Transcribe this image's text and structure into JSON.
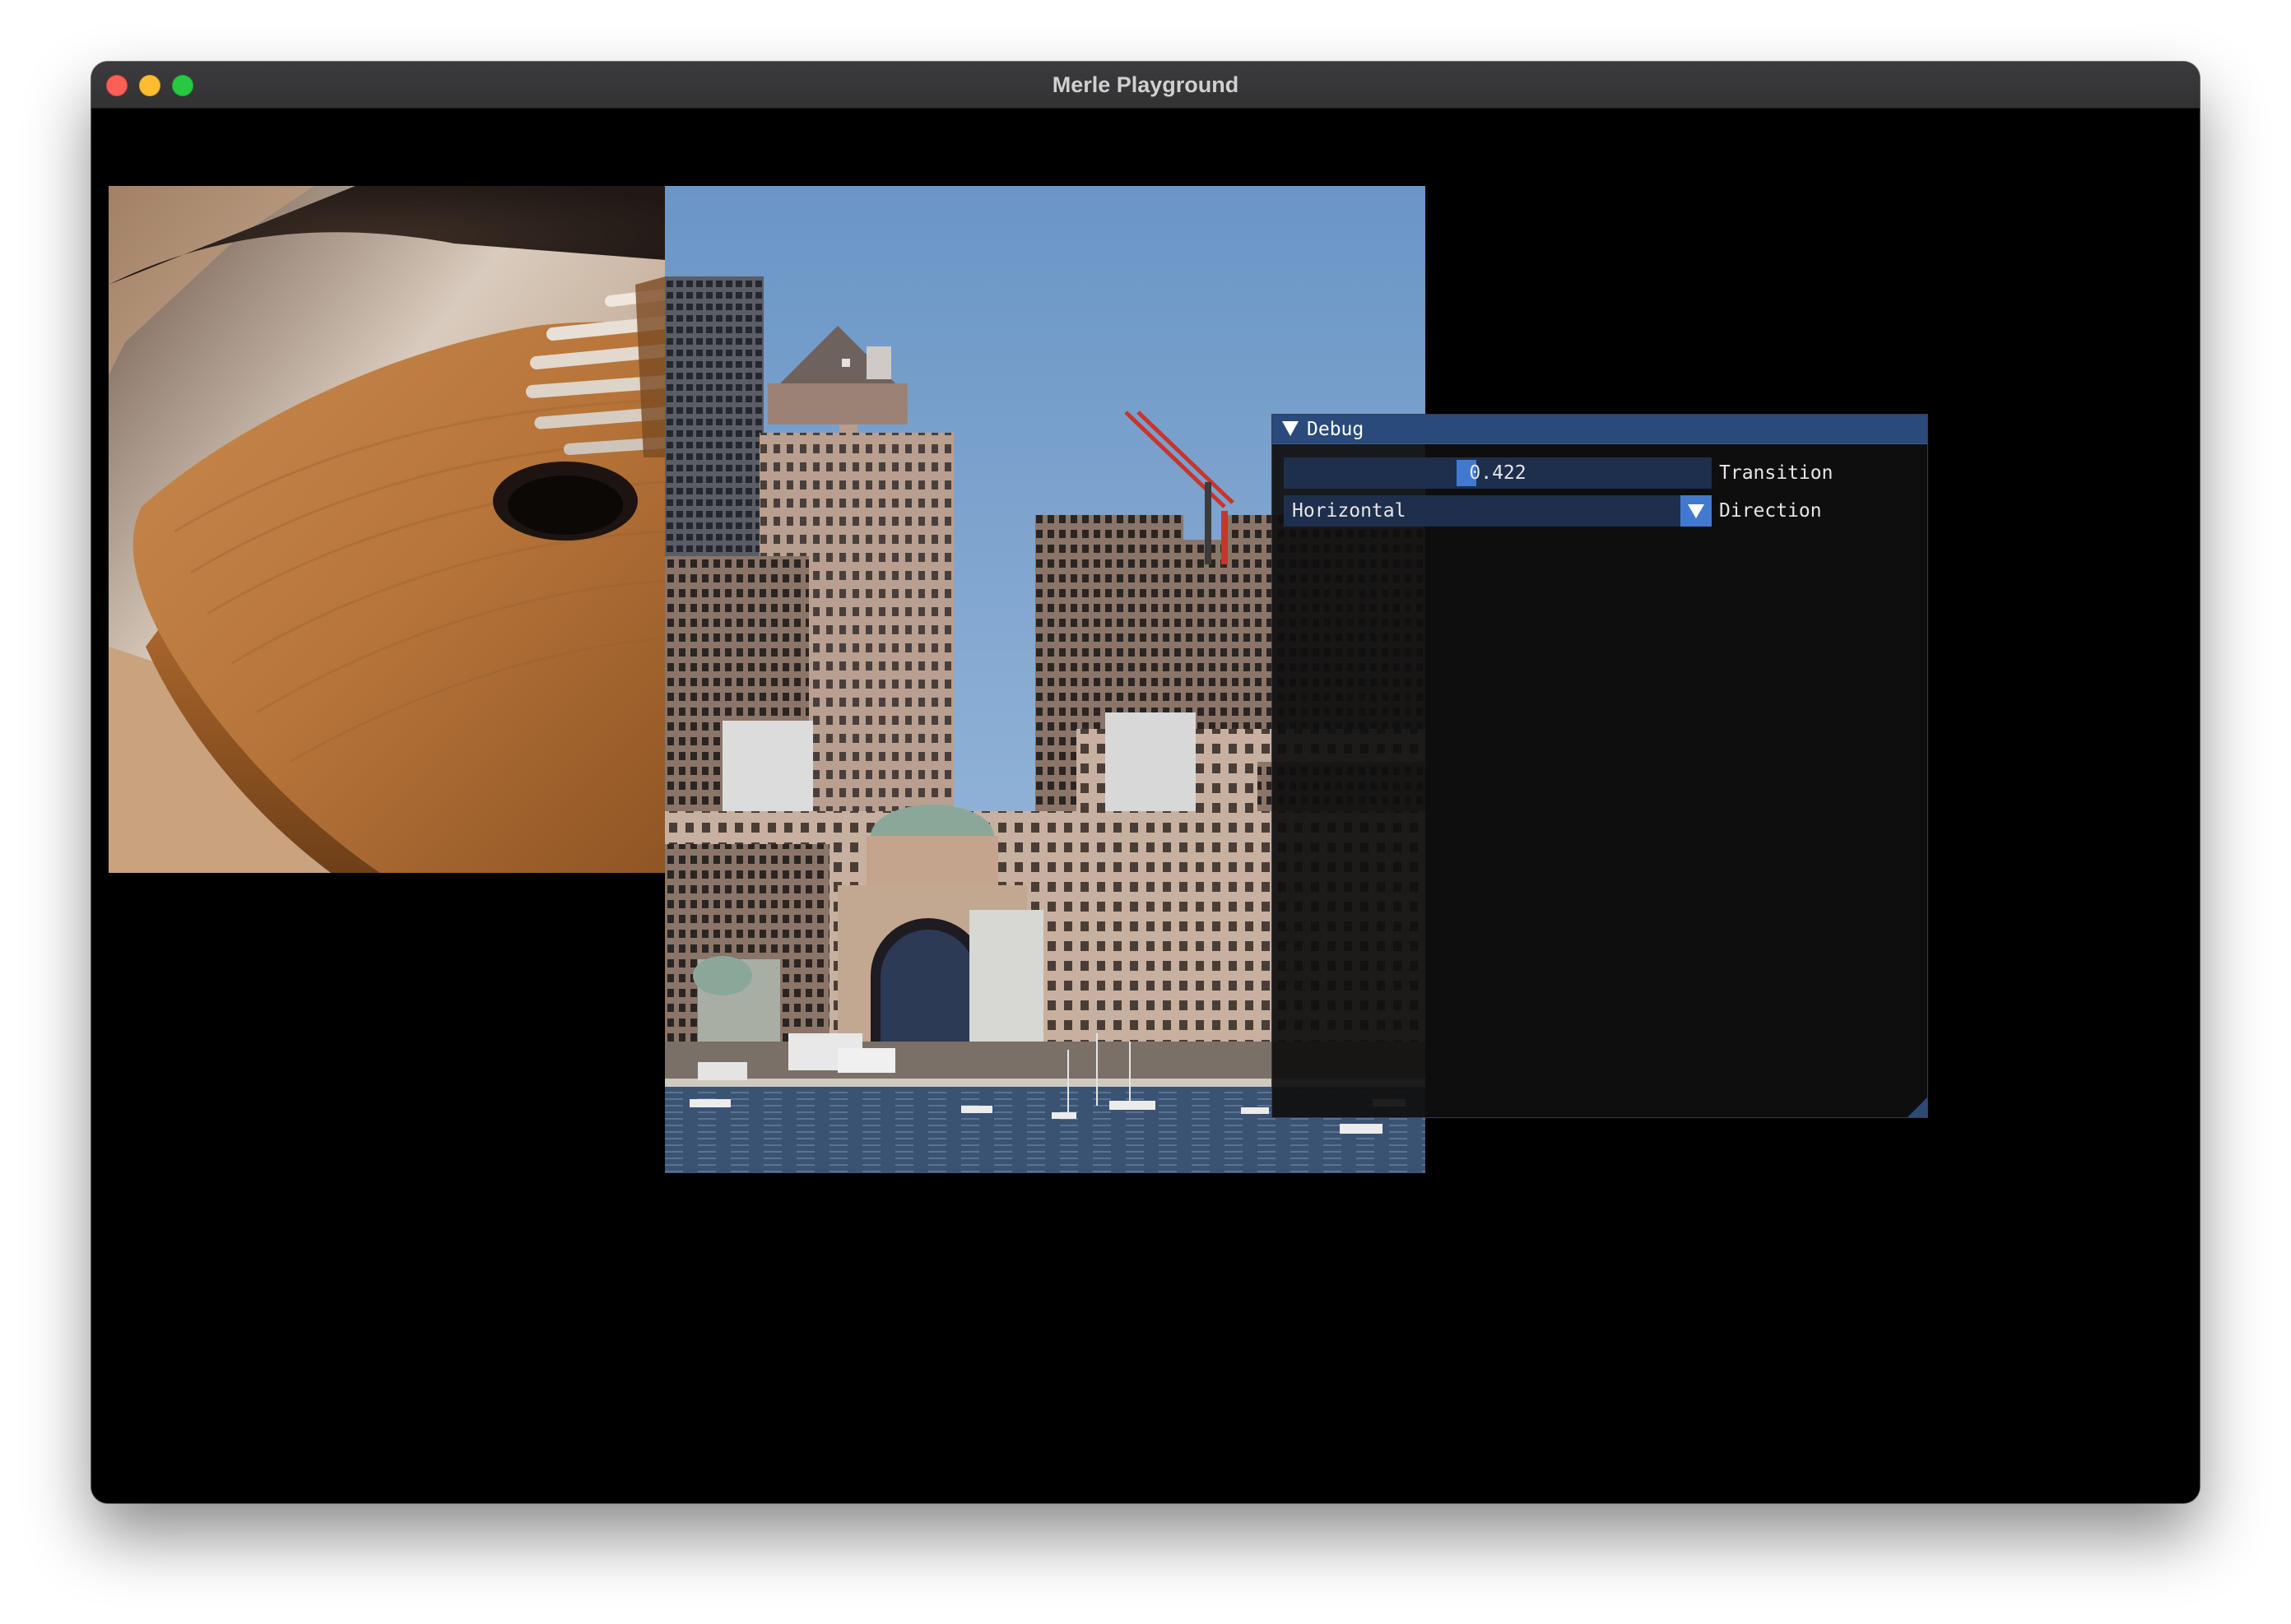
{
  "window": {
    "title": "Merle Playground"
  },
  "images": {
    "left": "kalimba-wood-photo",
    "right": "harbor-skyline-photo"
  },
  "debug": {
    "title": "Debug",
    "transition": {
      "value": "0.422",
      "fraction": 0.422,
      "label": "Transition"
    },
    "direction": {
      "value": "Horizontal",
      "label": "Direction"
    }
  },
  "colors": {
    "title_bar": "#294a7a",
    "frame_bg": "#1d2f4c",
    "accent": "#4279d0"
  },
  "icons": {
    "collapse": "collapse-arrow-icon",
    "combo": "dropdown-arrow-icon"
  }
}
